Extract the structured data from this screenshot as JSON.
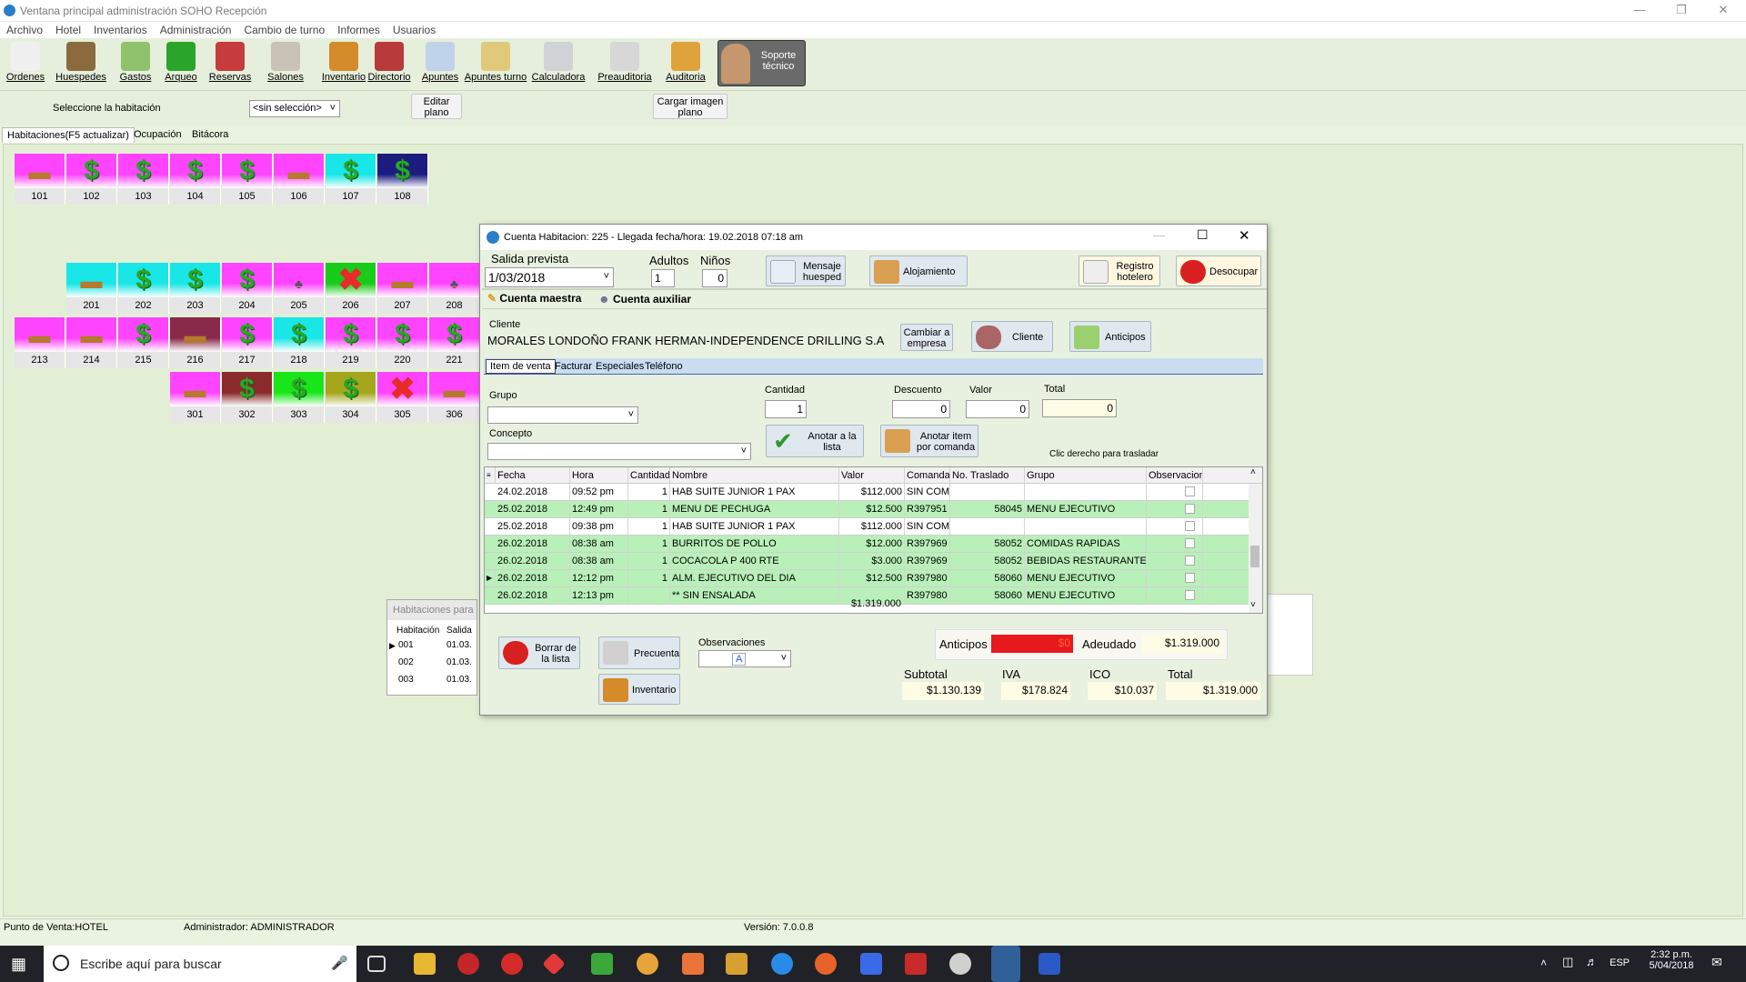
{
  "window": {
    "title": "Ventana principal administración SOHO Recepción"
  },
  "menu": [
    "Archivo",
    "Hotel",
    "Inventarios",
    "Administración",
    "Cambio de turno",
    "Informes",
    "Usuarios"
  ],
  "toolbar": [
    {
      "label": "Ordenes",
      "icon": "orders-icon",
      "color": "#f0f0f0"
    },
    {
      "label": "Huespedes",
      "icon": "guests-icon",
      "color": "#8b6a3e"
    },
    {
      "label": "Gastos",
      "icon": "expenses-icon",
      "color": "#8fc26b"
    },
    {
      "label": "Arqueo",
      "icon": "dollar-icon",
      "color": "#2aa52a"
    },
    {
      "label": "Reservas",
      "icon": "calendar-icon",
      "color": "#c63b3b"
    },
    {
      "label": "Salones",
      "icon": "house-icon",
      "color": "#c9c2b6"
    },
    {
      "label": "Inventario",
      "icon": "box-icon",
      "color": "#d48b2a"
    },
    {
      "label": "Directorio",
      "icon": "directory-icon",
      "color": "#b83a3a"
    },
    {
      "label": "Apuntes",
      "icon": "notes-icon",
      "color": "#bfd4ea"
    },
    {
      "label": "Apuntes turno",
      "icon": "shift-notes-icon",
      "color": "#e0c97a"
    },
    {
      "label": "Calculadora",
      "icon": "calculator-icon",
      "color": "#cfd3d6"
    },
    {
      "label": "Preauditoria",
      "icon": "magnifier-icon",
      "color": "#d7d7d7"
    },
    {
      "label": "Auditoria",
      "icon": "auditor-icon",
      "color": "#e0a23a"
    }
  ],
  "support": {
    "label": "Soporte técnico"
  },
  "room_select": {
    "label": "Seleccione la habitación",
    "value": "<sin selección>",
    "edit": "Editar plano",
    "load": "Cargar imagen plano"
  },
  "tabs": [
    "Habitaciones(F5 actualizar)",
    "Ocupación",
    "Bitácora"
  ],
  "rooms": [
    {
      "n": "101",
      "icon": "bed",
      "bg": "#ff44ff"
    },
    {
      "n": "102",
      "icon": "dollar",
      "bg": "#ff44ff"
    },
    {
      "n": "103",
      "icon": "dollar",
      "bg": "#ff44ff"
    },
    {
      "n": "104",
      "icon": "dollar",
      "bg": "#ff44ff"
    },
    {
      "n": "105",
      "icon": "dollar",
      "bg": "#ff44ff"
    },
    {
      "n": "106",
      "icon": "bed",
      "bg": "#ff44ff"
    },
    {
      "n": "107",
      "icon": "dollar",
      "bg": "#19e6e6"
    },
    {
      "n": "108",
      "icon": "dollar",
      "bg": "#1c1c80"
    },
    {
      "n": "201",
      "icon": "bed",
      "bg": "#19e6e6"
    },
    {
      "n": "202",
      "icon": "dollar",
      "bg": "#19e6e6"
    },
    {
      "n": "203",
      "icon": "dollar",
      "bg": "#19e6e6"
    },
    {
      "n": "204",
      "icon": "dollar",
      "bg": "#ff44ff"
    },
    {
      "n": "205",
      "icon": "brush",
      "bg": "#ff44ff"
    },
    {
      "n": "206",
      "icon": "x",
      "bg": "#19cc19"
    },
    {
      "n": "207",
      "icon": "bed",
      "bg": "#ff44ff"
    },
    {
      "n": "208",
      "icon": "brush",
      "bg": "#ff44ff"
    },
    {
      "n": "213",
      "icon": "bed",
      "bg": "#ff44ff"
    },
    {
      "n": "214",
      "icon": "bed",
      "bg": "#ff44ff"
    },
    {
      "n": "215",
      "icon": "dollar",
      "bg": "#ff44ff"
    },
    {
      "n": "216",
      "icon": "bed",
      "bg": "#8a2a4a"
    },
    {
      "n": "217",
      "icon": "dollar",
      "bg": "#ff44ff"
    },
    {
      "n": "218",
      "icon": "dollar",
      "bg": "#19e6e6"
    },
    {
      "n": "219",
      "icon": "dollar",
      "bg": "#ff44ff"
    },
    {
      "n": "220",
      "icon": "dollar",
      "bg": "#ff44ff"
    },
    {
      "n": "221",
      "icon": "dollar",
      "bg": "#ff44ff"
    },
    {
      "n": "301",
      "icon": "bed",
      "bg": "#ff44ff"
    },
    {
      "n": "302",
      "icon": "dollar",
      "bg": "#8a2a2a"
    },
    {
      "n": "303",
      "icon": "dollar",
      "bg": "#19e619"
    },
    {
      "n": "304",
      "icon": "dollar",
      "bg": "#a6a61c"
    },
    {
      "n": "305",
      "icon": "x",
      "bg": "#ff44ff"
    },
    {
      "n": "306",
      "icon": "bed",
      "bg": "#ff44ff"
    }
  ],
  "bg_panel": {
    "title": "Habitaciones para",
    "cols": [
      "Habitación",
      "Salida"
    ],
    "rows": [
      [
        "001",
        "01.03."
      ],
      [
        "002",
        "01.03."
      ],
      [
        "003",
        "01.03."
      ]
    ]
  },
  "dialog": {
    "title": "Cuenta Habitacion:  225  -  Llegada fecha/hora:  19.02.2018 07:18 am",
    "salida_label": "Salida prevista",
    "salida_value": "1/03/2018",
    "adultos_label": "Adultos",
    "adultos_value": "1",
    "ninos_label": "Niños",
    "ninos_value": "0",
    "btn_mensaje": "Mensaje huesped",
    "btn_alojamiento": "Alojamiento",
    "btn_registro": "Registro hotelero",
    "btn_desocupar": "Desocupar",
    "tab_master": "Cuenta maestra",
    "tab_aux": "Cuenta auxiliar",
    "cliente_label": "Cliente",
    "cliente_value": "MORALES LONDOÑO FRANK HERMAN-INDEPENDENCE DRILLING S.A",
    "btn_cambiar": "Cambiar a empresa",
    "btn_cliente": "Cliente",
    "btn_anticipos": "Anticipos",
    "subtabs": [
      "Item de venta",
      "Facturar",
      "Especiales",
      "Teléfono"
    ],
    "grupo_label": "Grupo",
    "concepto_label": "Concepto",
    "cantidad_label": "Cantidad",
    "cantidad_value": "1",
    "descuento_label": "Descuento",
    "descuento_value": "0",
    "valor_label": "Valor",
    "valor_value": "0",
    "total_label": "Total",
    "total_value": "0",
    "btn_anotar": "Anotar a la lista",
    "btn_anotar_comanda": "Anotar item por comanda",
    "hint": "Clic derecho para trasladar",
    "grid_cols": [
      "Fecha",
      "Hora",
      "Cantidad",
      "Nombre",
      "Valor",
      "Comanda",
      "No. Traslado",
      "Grupo",
      "Observacion"
    ],
    "grid_rows": [
      [
        "24.02.2018",
        "09:52 pm",
        "1",
        "HAB SUITE JUNIOR 1 PAX",
        "$112.000",
        "SIN COM",
        "",
        "",
        ""
      ],
      [
        "25.02.2018",
        "12:49 pm",
        "1",
        "MENU DE PECHUGA",
        "$12.500",
        "R397951",
        "58045",
        "MENU EJECUTIVO",
        ""
      ],
      [
        "25.02.2018",
        "09:38 pm",
        "1",
        "HAB SUITE JUNIOR 1 PAX",
        "$112.000",
        "SIN COM",
        "",
        "",
        ""
      ],
      [
        "26.02.2018",
        "08:38 am",
        "1",
        "BURRITOS DE POLLO",
        "$12.000",
        "R397969",
        "58052",
        "COMIDAS RAPIDAS",
        ""
      ],
      [
        "26.02.2018",
        "08:38 am",
        "1",
        "COCACOLA P 400 RTE",
        "$3.000",
        "R397969",
        "58052",
        "BEBIDAS RESTAURANTE",
        ""
      ],
      [
        "26.02.2018",
        "12:12 pm",
        "1",
        "ALM. EJECUTIVO DEL DIA",
        "$12.500",
        "R397980",
        "58060",
        "MENU EJECUTIVO",
        ""
      ],
      [
        "26.02.2018",
        "12:13 pm",
        "",
        "** SIN ENSALADA",
        "",
        "R397980",
        "58060",
        "MENU EJECUTIVO",
        ""
      ]
    ],
    "grid_total": "$1.319.000",
    "btn_borrar": "Borrar de la lista",
    "btn_precuenta": "Precuenta",
    "btn_inventario": "Inventario",
    "obs_label": "Observaciones",
    "anticipos_label": "Anticipos",
    "anticipos_value": "$0",
    "adeudado_label": "Adeudado",
    "adeudado_value": "$1.319.000",
    "subtotal_label": "Subtotal",
    "subtotal_value": "$1.130.139",
    "iva_label": "IVA",
    "iva_value": "$178.824",
    "ico_label": "ICO",
    "ico_value": "$10.037",
    "total2_label": "Total",
    "total2_value": "$1.319.000"
  },
  "status": {
    "pos": "Punto de Venta:HOTEL",
    "admin": "Administrador: ADMINISTRADOR",
    "version": "Versión: 7.0.0.8"
  },
  "taskbar": {
    "search": "Escribe aquí para buscar",
    "lang": "ESP",
    "time": "2:32 p.m.",
    "date": "5/04/2018"
  }
}
